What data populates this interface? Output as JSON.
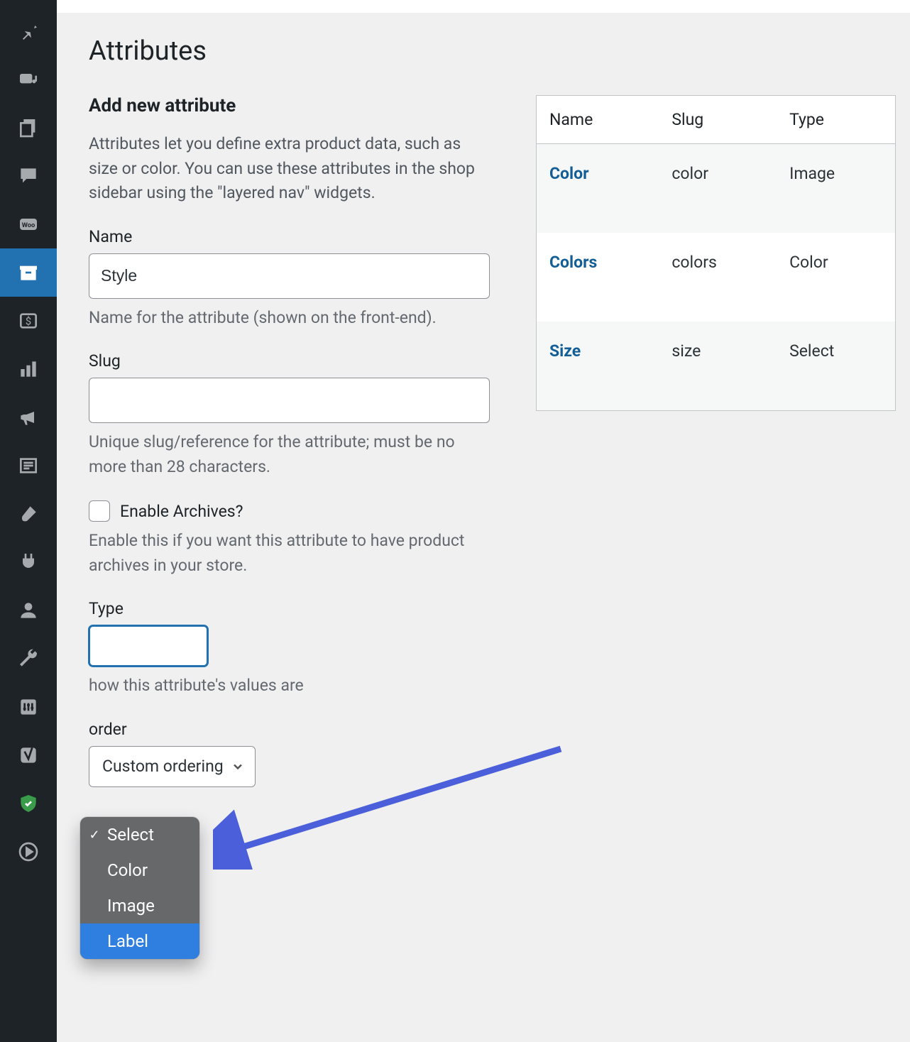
{
  "page": {
    "title": "Attributes"
  },
  "form": {
    "heading": "Add new attribute",
    "intro": "Attributes let you define extra product data, such as size or color. You can use these attributes in the shop sidebar using the \"layered nav\" widgets.",
    "name_label": "Name",
    "name_value": "Style",
    "name_help": "Name for the attribute (shown on the front-end).",
    "slug_label": "Slug",
    "slug_value": "",
    "slug_help": "Unique slug/reference for the attribute; must be no more than 28 characters.",
    "archives_label": "Enable Archives?",
    "archives_help": "Enable this if you want this attribute to have product archives in your store.",
    "type_label": "Type",
    "type_help_partial": " how this attribute's values are",
    "sortorder_label_suffix": " order",
    "default_sort_value": "Custom ordering"
  },
  "type_dropdown": {
    "options": [
      "Select",
      "Color",
      "Image",
      "Label"
    ],
    "checked_index": 0,
    "highlight_index": 3
  },
  "table": {
    "headers": {
      "name": "Name",
      "slug": "Slug",
      "type": "Type"
    },
    "rows": [
      {
        "name": "Color",
        "slug": "color",
        "type": "Image"
      },
      {
        "name": "Colors",
        "slug": "colors",
        "type": "Color"
      },
      {
        "name": "Size",
        "slug": "size",
        "type": "Select"
      }
    ]
  }
}
